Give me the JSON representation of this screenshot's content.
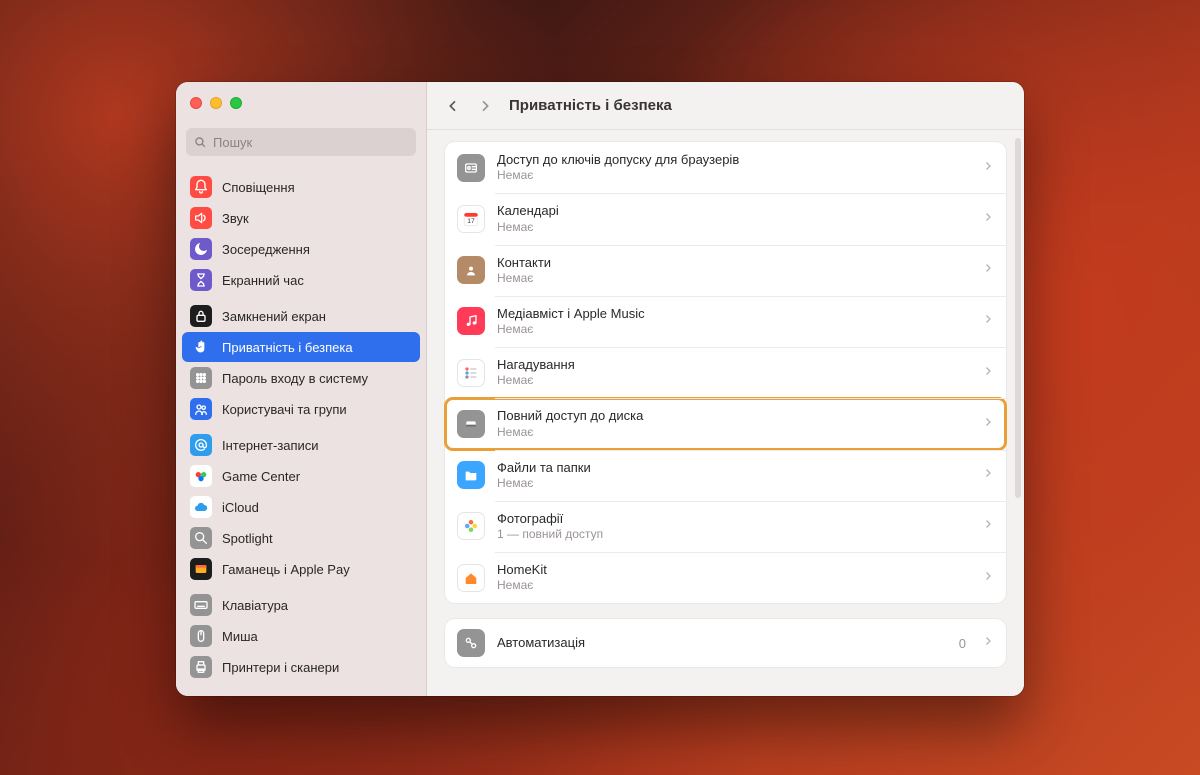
{
  "window": {
    "title": "Приватність і безпека"
  },
  "search": {
    "placeholder": "Пошук"
  },
  "sidebar_groups": [
    [
      {
        "label": "Сповіщення",
        "icon_bg": "#ff4b41",
        "glyph": "bell"
      },
      {
        "label": "Звук",
        "icon_bg": "#ff4b41",
        "glyph": "speaker"
      },
      {
        "label": "Зосередження",
        "icon_bg": "#6e5acb",
        "glyph": "moon"
      },
      {
        "label": "Екранний час",
        "icon_bg": "#6e5acb",
        "glyph": "hourglass"
      }
    ],
    [
      {
        "label": "Замкнений екран",
        "icon_bg": "#1d1d1d",
        "glyph": "lock"
      },
      {
        "label": "Приватність і безпека",
        "icon_bg": "#2f6fed",
        "glyph": "hand",
        "active": true
      },
      {
        "label": "Пароль входу в систему",
        "icon_bg": "#949494",
        "glyph": "grid"
      },
      {
        "label": "Користувачі та групи",
        "icon_bg": "#2f6fed",
        "glyph": "users"
      }
    ],
    [
      {
        "label": "Інтернет-записи",
        "icon_bg": "#2f9ced",
        "glyph": "at"
      },
      {
        "label": "Game Center",
        "icon_bg": "#ffffff",
        "glyph": "gamecenter",
        "fg": "#ff3b30"
      },
      {
        "label": "iCloud",
        "icon_bg": "#ffffff",
        "glyph": "cloud",
        "fg": "#2f9ced"
      },
      {
        "label": "Spotlight",
        "icon_bg": "#949494",
        "glyph": "search"
      },
      {
        "label": "Гаманець і Apple Pay",
        "icon_bg": "#1d1d1d",
        "glyph": "wallet"
      }
    ],
    [
      {
        "label": "Клавіатура",
        "icon_bg": "#949494",
        "glyph": "keyboard"
      },
      {
        "label": "Миша",
        "icon_bg": "#949494",
        "glyph": "mouse"
      },
      {
        "label": "Принтери і сканери",
        "icon_bg": "#949494",
        "glyph": "printer"
      }
    ]
  ],
  "panels": [
    [
      {
        "title": "Доступ до ключів допуску для браузерів",
        "sub": "Немає",
        "icon_bg": "#949494",
        "glyph": "idcard"
      },
      {
        "title": "Календарі",
        "sub": "Немає",
        "icon_bg": "#ffffff",
        "glyph": "calendar",
        "fg": "#ff3b30"
      },
      {
        "title": "Контакти",
        "sub": "Немає",
        "icon_bg": "#b58a66",
        "glyph": "contact"
      },
      {
        "title": "Медіавміст і Apple Music",
        "sub": "Немає",
        "icon_bg": "#ff3b58",
        "glyph": "music"
      },
      {
        "title": "Нагадування",
        "sub": "Немає",
        "icon_bg": "#ffffff",
        "glyph": "reminders",
        "fg": "#ff6a3b"
      },
      {
        "title": "Повний доступ до диска",
        "sub": "Немає",
        "icon_bg": "#949494",
        "glyph": "disk",
        "highlight": true
      },
      {
        "title": "Файли та папки",
        "sub": "Немає",
        "icon_bg": "#3aa6ff",
        "glyph": "folder"
      },
      {
        "title": "Фотографії",
        "sub": "1 — повний доступ",
        "icon_bg": "#ffffff",
        "glyph": "photos",
        "fg": "#ff6a3b"
      },
      {
        "title": "HomeKit",
        "sub": "Немає",
        "icon_bg": "#ffffff",
        "glyph": "home",
        "fg": "#ff8a2d"
      }
    ],
    [
      {
        "title": "Автоматизація",
        "sub": "",
        "trail": "0",
        "icon_bg": "#949494",
        "glyph": "automation"
      }
    ]
  ],
  "colors": {
    "accent": "#2f6fed",
    "highlight": "#e9a038"
  }
}
